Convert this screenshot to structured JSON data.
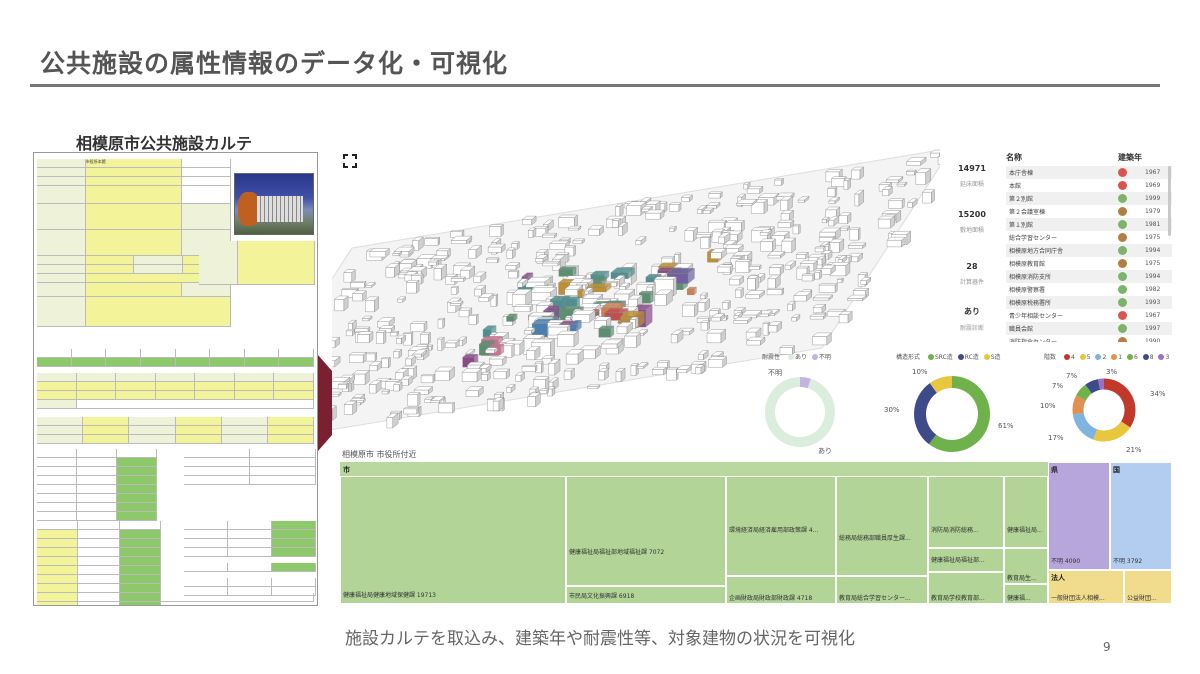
{
  "slide": {
    "title": "公共施設の属性情報のデータ化・可視化",
    "footer": "施設カルテを取込み、建築年や耐震性等、対象建物の状況を可視化",
    "page_number": "9"
  },
  "karte": {
    "heading": "相模原市公共施設カルテ",
    "facility_name": "市役所本館"
  },
  "map": {
    "caption": "相模原市 市役所付近"
  },
  "kpis": [
    {
      "value": "14971",
      "label": "延床面積"
    },
    {
      "value": "15200",
      "label": "敷地面積"
    },
    {
      "value": "28",
      "label": "計算器件"
    },
    {
      "value": "あり",
      "label": "耐震診断"
    }
  ],
  "building_list": {
    "header_name": "名称",
    "header_year": "建築年",
    "rows": [
      {
        "name": "本庁舎棟",
        "year": "1967",
        "color": "#d9534f"
      },
      {
        "name": "本館",
        "year": "1969",
        "color": "#d9534f"
      },
      {
        "name": "第２別館",
        "year": "1999",
        "color": "#7cb46a"
      },
      {
        "name": "第２会議室棟",
        "year": "1979",
        "color": "#b08040"
      },
      {
        "name": "第１別館",
        "year": "1981",
        "color": "#7cb46a"
      },
      {
        "name": "総合学習センター",
        "year": "1975",
        "color": "#b08040"
      },
      {
        "name": "相模原地方合同庁舎",
        "year": "1994",
        "color": "#7cb46a"
      },
      {
        "name": "相模原教育館",
        "year": "1975",
        "color": "#b08040"
      },
      {
        "name": "相模原消防支所",
        "year": "1994",
        "color": "#7cb46a"
      },
      {
        "name": "相模原警察署",
        "year": "1982",
        "color": "#7cb46a"
      },
      {
        "name": "相模原税務署所",
        "year": "1993",
        "color": "#7cb46a"
      },
      {
        "name": "青少年相談センター",
        "year": "1967",
        "color": "#d9534f"
      },
      {
        "name": "職員会館",
        "year": "1997",
        "color": "#7cb46a"
      },
      {
        "name": "消防指令センター",
        "year": "1990",
        "color": "#b08040"
      }
    ]
  },
  "donut_quake": {
    "legend_title": "耐震性",
    "legend": [
      {
        "label": "あり",
        "color": "#dbeedd"
      },
      {
        "label": "不明",
        "color": "#c4b2e0"
      }
    ],
    "label_unknown": "不明",
    "label_yes": "あり",
    "chart_data": {
      "type": "pie",
      "categories": [
        "あり",
        "不明"
      ],
      "values": [
        95,
        5
      ]
    }
  },
  "donut_struct": {
    "legend_title": "構造形式",
    "legend": [
      {
        "label": "SRC造",
        "color": "#6fb24b"
      },
      {
        "label": "RC造",
        "color": "#3e4b8a"
      },
      {
        "label": "S造",
        "color": "#e8c63e"
      }
    ],
    "labels": [
      "10%",
      "30%",
      "61%"
    ],
    "chart_data": {
      "type": "pie",
      "categories": [
        "SRC造",
        "RC造",
        "S造"
      ],
      "values": [
        61,
        30,
        10
      ]
    }
  },
  "donut_floors": {
    "legend_title": "階数",
    "legend": [
      {
        "label": "4",
        "color": "#c0392b"
      },
      {
        "label": "5",
        "color": "#e8c63e"
      },
      {
        "label": "2",
        "color": "#7fb3e0"
      },
      {
        "label": "1",
        "color": "#e09050"
      },
      {
        "label": "6",
        "color": "#6fb24b"
      },
      {
        "label": "8",
        "color": "#3e4b8a"
      },
      {
        "label": "3",
        "color": "#9b6fc8"
      }
    ],
    "labels": [
      "3%",
      "7%",
      "7%",
      "10%",
      "17%",
      "21%",
      "34%"
    ],
    "chart_data": {
      "type": "pie",
      "categories": [
        "4",
        "5",
        "2",
        "1",
        "6",
        "8",
        "3"
      ],
      "values": [
        34,
        21,
        17,
        10,
        7,
        7,
        3
      ]
    }
  },
  "treemap": {
    "h_city": "市",
    "h_pref": "県",
    "h_nation": "国",
    "h_corp": "法人",
    "cells": [
      "健康福祉局健康地域保健課 19713",
      "健康福祉局福祉部地域福祉課 7072",
      "市民局文化振興課 6918",
      "環境経済局経済雇用部政策課 4...",
      "企画財政局財政部財政課 4718",
      "総務局総務部職員厚生課...",
      "教育局総合学習センター...",
      "消防局消防総務...",
      "健康福祉局...",
      "健康福祉局福祉部...",
      "教育局生...",
      "教育局学校教育部...",
      "健康福...",
      "不明 4090",
      "不明 3792",
      "一般財団法人相模...",
      "公益財団..."
    ]
  }
}
